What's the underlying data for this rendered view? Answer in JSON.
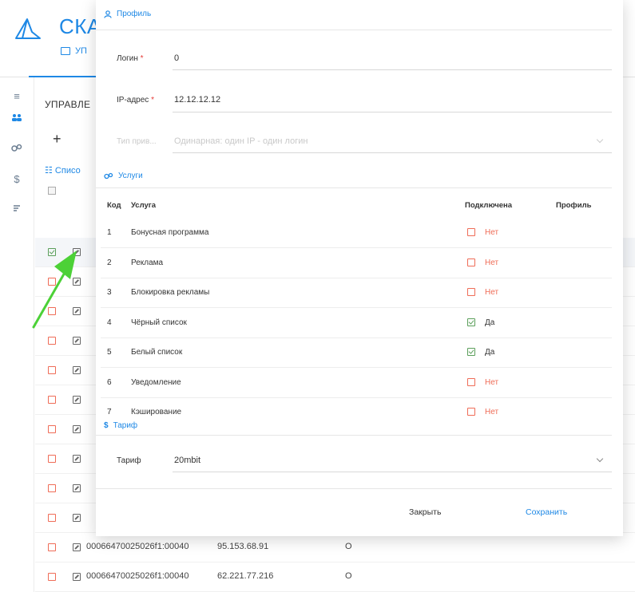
{
  "app": {
    "title": "СКА",
    "subnav_label": "УП",
    "section_title": "УПРАВЛЕ",
    "add_label": "+",
    "list_label": "Списо",
    "rail_icons": [
      "menu-icon",
      "users-icon",
      "services-icon",
      "dollar-icon",
      "tariff-icon"
    ]
  },
  "background_rows": [
    {
      "checked": true,
      "id": "",
      "ip": "",
      "status": ""
    },
    {
      "checked": false,
      "id": "",
      "ip": "",
      "status": ""
    },
    {
      "checked": false,
      "id": "",
      "ip": "",
      "status": ""
    },
    {
      "checked": false,
      "id": "",
      "ip": "",
      "status": ""
    },
    {
      "checked": false,
      "id": "",
      "ip": "",
      "status": ""
    },
    {
      "checked": false,
      "id": "",
      "ip": "",
      "status": ""
    },
    {
      "checked": false,
      "id": "",
      "ip": "",
      "status": ""
    },
    {
      "checked": false,
      "id": "",
      "ip": "",
      "status": ""
    },
    {
      "checked": false,
      "id": "",
      "ip": "",
      "status": ""
    },
    {
      "checked": false,
      "id": "",
      "ip": "",
      "status": ""
    },
    {
      "checked": false,
      "id": "00066470025026f1:00040",
      "ip": "95.153.68.91",
      "status": "O"
    },
    {
      "checked": false,
      "id": "00066470025026f1:00040",
      "ip": "62.221.77.216",
      "status": "O"
    }
  ],
  "modal": {
    "profile": {
      "header": "Профиль",
      "login_label": "Логин",
      "login_value": "0",
      "ip_label": "IP-адрес",
      "ip_value": "12.12.12.12",
      "type_label": "Тип прив...",
      "type_value": "Одинарная: один IP - один логин"
    },
    "services": {
      "header": "Услуги",
      "columns": {
        "code": "Код",
        "service": "Услуга",
        "connected": "Подключена",
        "profile": "Профиль"
      },
      "rows": [
        {
          "code": "1",
          "name": "Бонусная программа",
          "connected": false,
          "status": "Нет"
        },
        {
          "code": "2",
          "name": "Реклама",
          "connected": false,
          "status": "Нет"
        },
        {
          "code": "3",
          "name": "Блокировка рекламы",
          "connected": false,
          "status": "Нет"
        },
        {
          "code": "4",
          "name": "Чёрный список",
          "connected": true,
          "status": "Да"
        },
        {
          "code": "5",
          "name": "Белый список",
          "connected": true,
          "status": "Да"
        },
        {
          "code": "6",
          "name": "Уведомление",
          "connected": false,
          "status": "Нет"
        },
        {
          "code": "7",
          "name": "Кэширование",
          "connected": false,
          "status": "Нет"
        }
      ]
    },
    "tariff": {
      "header": "Тариф",
      "label": "Тариф",
      "value": "20mbit"
    },
    "buttons": {
      "close": "Закрыть",
      "save": "Сохранить"
    }
  },
  "colors": {
    "accent": "#1e88e5",
    "no": "#ef6c57",
    "yes": "#5b9f5b",
    "arrow": "#4cd137"
  }
}
